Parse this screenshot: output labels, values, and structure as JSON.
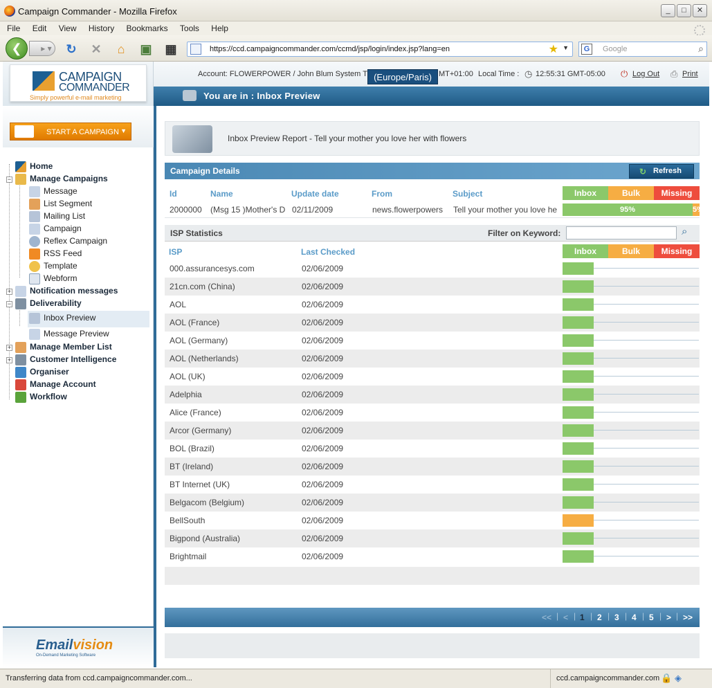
{
  "window": {
    "title": "Campaign Commander - Mozilla Firefox",
    "controls": [
      "_",
      "□",
      "✕"
    ]
  },
  "menu": [
    "File",
    "Edit",
    "View",
    "History",
    "Bookmarks",
    "Tools",
    "Help"
  ],
  "nav": {
    "url": "https://ccd.campaigncommander.com/ccmd/jsp/login/index.jsp?lang=en",
    "search_placeholder": "Google",
    "search_engine": "G"
  },
  "logo": {
    "line1": "CAMPAIGN",
    "line2": "COMMANDER",
    "tagline": "Simply powerful e-mail marketing"
  },
  "topinfo": {
    "account": "Account:  FLOWERPOWER / John Blum   System Ti",
    "timezone_tip": "(Europe/Paris)",
    "gmt": "MT+01:00",
    "local_time_label": "Local Time :",
    "local_time": "12:55:31 GMT-05:00",
    "logout": "Log Out",
    "print": "Print"
  },
  "banner": {
    "text": "You are in : Inbox Preview"
  },
  "sidebar": {
    "start_campaign": "START A CAMPAIGN",
    "tree": {
      "home": "Home",
      "manage_campaigns": "Manage Campaigns",
      "message": "Message",
      "list_segment": "List Segment",
      "mailing_list": "Mailing List",
      "campaign": "Campaign",
      "reflex_campaign": "Reflex Campaign",
      "rss_feed": "RSS Feed",
      "template": "Template",
      "webform": "Webform",
      "notification_messages": "Notification messages",
      "deliverability": "Deliverability",
      "inbox_preview": "Inbox Preview",
      "message_preview": "Message Preview",
      "manage_member_list": "Manage Member List",
      "customer_intelligence": "Customer Intelligence",
      "organiser": "Organiser",
      "manage_account": "Manage Account",
      "workflow": "Workflow"
    },
    "emailvision": {
      "name_a": "Email",
      "name_b": "vision",
      "tagline": "On-Demand Marketing Software"
    }
  },
  "report": {
    "title": "Inbox Preview Report - Tell your mother you love her with flowers"
  },
  "campaign_details": {
    "title": "Campaign Details",
    "refresh": "Refresh",
    "headers": {
      "id": "Id",
      "name": "Name",
      "update_date": "Update date",
      "from": "From",
      "subject": "Subject"
    },
    "status_headers": {
      "inbox": "Inbox",
      "bulk": "Bulk",
      "missing": "Missing"
    },
    "row": {
      "id": "2000000",
      "name": "(Msg 15 )Mother's D",
      "update_date": "02/11/2009",
      "from": "news.flowerpowers",
      "subject": "Tell your mother you love he",
      "inbox_pct": "95%",
      "missing_pct": "5%",
      "inbox_fraction": 0.95
    }
  },
  "isp_stats": {
    "title": "ISP Statistics",
    "filter_label": "Filter on Keyword:",
    "filter_value": "",
    "headers": {
      "isp": "ISP",
      "last_checked": "Last Checked"
    },
    "rows": [
      {
        "isp": "000.assurancesys.com",
        "date": "02/06/2009",
        "status": "inbox"
      },
      {
        "isp": "21cn.com (China)",
        "date": "02/06/2009",
        "status": "inbox"
      },
      {
        "isp": "AOL",
        "date": "02/06/2009",
        "status": "inbox"
      },
      {
        "isp": "AOL (France)",
        "date": "02/06/2009",
        "status": "inbox"
      },
      {
        "isp": "AOL (Germany)",
        "date": "02/06/2009",
        "status": "inbox"
      },
      {
        "isp": "AOL (Netherlands)",
        "date": "02/06/2009",
        "status": "inbox"
      },
      {
        "isp": "AOL (UK)",
        "date": "02/06/2009",
        "status": "inbox"
      },
      {
        "isp": "Adelphia",
        "date": "02/06/2009",
        "status": "inbox"
      },
      {
        "isp": "Alice (France)",
        "date": "02/06/2009",
        "status": "inbox"
      },
      {
        "isp": "Arcor (Germany)",
        "date": "02/06/2009",
        "status": "inbox"
      },
      {
        "isp": "BOL (Brazil)",
        "date": "02/06/2009",
        "status": "inbox"
      },
      {
        "isp": "BT (Ireland)",
        "date": "02/06/2009",
        "status": "inbox"
      },
      {
        "isp": "BT Internet (UK)",
        "date": "02/06/2009",
        "status": "inbox"
      },
      {
        "isp": "Belgacom (Belgium)",
        "date": "02/06/2009",
        "status": "inbox"
      },
      {
        "isp": "BellSouth",
        "date": "02/06/2009",
        "status": "bulk"
      },
      {
        "isp": "Bigpond (Australia)",
        "date": "02/06/2009",
        "status": "inbox"
      },
      {
        "isp": "Brightmail",
        "date": "02/06/2009",
        "status": "inbox"
      }
    ]
  },
  "pager": {
    "first": "<<",
    "prev": "<",
    "pages": [
      "1",
      "2",
      "3",
      "4",
      "5"
    ],
    "next": ">",
    "last": ">>",
    "current": "1"
  },
  "statusbar": {
    "left": "Transferring data from ccd.campaigncommander.com...",
    "right": "ccd.campaigncommander.com"
  },
  "colors": {
    "inbox": "#8bc86a",
    "bulk": "#f6ad43",
    "missing": "#ee4d3d",
    "brand_blue": "#2f6b98"
  }
}
